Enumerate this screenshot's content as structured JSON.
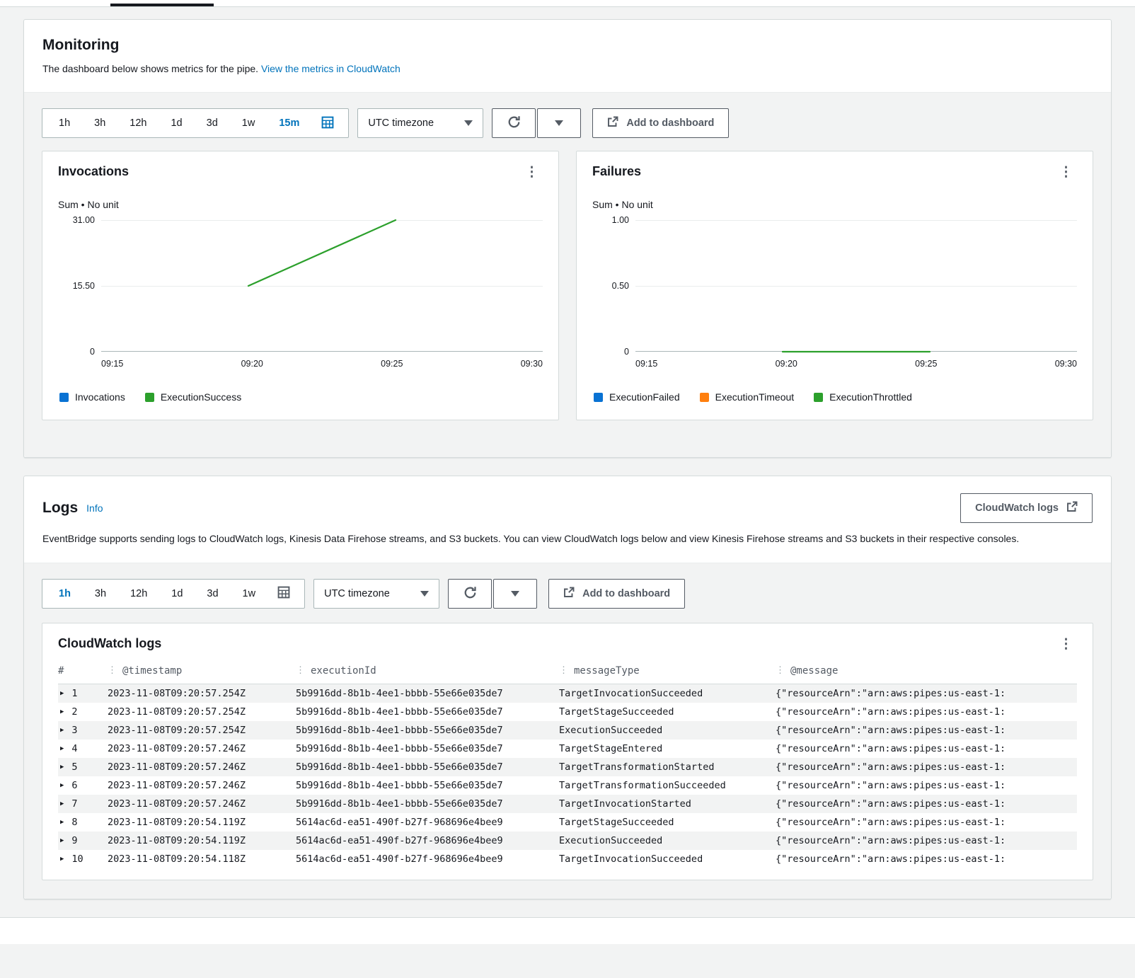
{
  "icons": {
    "kebab_menu": "⋮",
    "expand_row": "▶"
  },
  "colors": {
    "accent_blue": "#0073bb",
    "button_gray": "#545b64",
    "chart_blue": "#0972d3",
    "chart_green": "#2ca02c",
    "chart_orange": "#ff7f0e"
  },
  "monitoring": {
    "title": "Monitoring",
    "description": "The dashboard below shows metrics for the pipe.",
    "metrics_link": "View the metrics in CloudWatch",
    "time_ranges": [
      "1h",
      "3h",
      "12h",
      "1d",
      "3d",
      "1w",
      "15m"
    ],
    "selected_range": "15m",
    "timezone_label": "UTC timezone",
    "add_to_dashboard_label": "Add to dashboard"
  },
  "logs": {
    "title": "Logs",
    "info_label": "Info",
    "cloudwatch_logs_button": "CloudWatch logs",
    "description": "EventBridge supports sending logs to CloudWatch logs, Kinesis Data Firehose streams, and S3 buckets. You can view CloudWatch logs below and view Kinesis Firehose streams and S3 buckets in their respective consoles.",
    "time_ranges": [
      "1h",
      "3h",
      "12h",
      "1d",
      "3d",
      "1w"
    ],
    "selected_range": "1h",
    "timezone_label": "UTC timezone",
    "add_to_dashboard_label": "Add to dashboard",
    "table": {
      "title": "CloudWatch logs",
      "columns": [
        "#",
        "@timestamp",
        "executionId",
        "messageType",
        "@message"
      ],
      "rows": [
        {
          "n": "1",
          "timestamp": "2023-11-08T09:20:57.254Z",
          "executionId": "5b9916dd-8b1b-4ee1-bbbb-55e66e035de7",
          "messageType": "TargetInvocationSucceeded",
          "message": "{\"resourceArn\":\"arn:aws:pipes:us-east-1:"
        },
        {
          "n": "2",
          "timestamp": "2023-11-08T09:20:57.254Z",
          "executionId": "5b9916dd-8b1b-4ee1-bbbb-55e66e035de7",
          "messageType": "TargetStageSucceeded",
          "message": "{\"resourceArn\":\"arn:aws:pipes:us-east-1:"
        },
        {
          "n": "3",
          "timestamp": "2023-11-08T09:20:57.254Z",
          "executionId": "5b9916dd-8b1b-4ee1-bbbb-55e66e035de7",
          "messageType": "ExecutionSucceeded",
          "message": "{\"resourceArn\":\"arn:aws:pipes:us-east-1:"
        },
        {
          "n": "4",
          "timestamp": "2023-11-08T09:20:57.246Z",
          "executionId": "5b9916dd-8b1b-4ee1-bbbb-55e66e035de7",
          "messageType": "TargetStageEntered",
          "message": "{\"resourceArn\":\"arn:aws:pipes:us-east-1:"
        },
        {
          "n": "5",
          "timestamp": "2023-11-08T09:20:57.246Z",
          "executionId": "5b9916dd-8b1b-4ee1-bbbb-55e66e035de7",
          "messageType": "TargetTransformationStarted",
          "message": "{\"resourceArn\":\"arn:aws:pipes:us-east-1:"
        },
        {
          "n": "6",
          "timestamp": "2023-11-08T09:20:57.246Z",
          "executionId": "5b9916dd-8b1b-4ee1-bbbb-55e66e035de7",
          "messageType": "TargetTransformationSucceeded",
          "message": "{\"resourceArn\":\"arn:aws:pipes:us-east-1:"
        },
        {
          "n": "7",
          "timestamp": "2023-11-08T09:20:57.246Z",
          "executionId": "5b9916dd-8b1b-4ee1-bbbb-55e66e035de7",
          "messageType": "TargetInvocationStarted",
          "message": "{\"resourceArn\":\"arn:aws:pipes:us-east-1:"
        },
        {
          "n": "8",
          "timestamp": "2023-11-08T09:20:54.119Z",
          "executionId": "5614ac6d-ea51-490f-b27f-968696e4bee9",
          "messageType": "TargetStageSucceeded",
          "message": "{\"resourceArn\":\"arn:aws:pipes:us-east-1:"
        },
        {
          "n": "9",
          "timestamp": "2023-11-08T09:20:54.119Z",
          "executionId": "5614ac6d-ea51-490f-b27f-968696e4bee9",
          "messageType": "ExecutionSucceeded",
          "message": "{\"resourceArn\":\"arn:aws:pipes:us-east-1:"
        },
        {
          "n": "10",
          "timestamp": "2023-11-08T09:20:54.118Z",
          "executionId": "5614ac6d-ea51-490f-b27f-968696e4bee9",
          "messageType": "TargetInvocationSucceeded",
          "message": "{\"resourceArn\":\"arn:aws:pipes:us-east-1:"
        }
      ]
    }
  },
  "chart_data": [
    {
      "type": "line",
      "title": "Invocations",
      "subtitle": "Sum • No unit",
      "x_ticks": [
        "09:15",
        "09:20",
        "09:25",
        "09:30"
      ],
      "y_ticks": [
        "31.00",
        "15.50",
        "0"
      ],
      "ylim": [
        0,
        31
      ],
      "grid": true,
      "legend_position": "bottom",
      "series": [
        {
          "name": "Invocations",
          "color": "#0972d3",
          "points": []
        },
        {
          "name": "ExecutionSuccess",
          "color": "#2ca02c",
          "points": [
            {
              "x": "09:20",
              "y": 15.5
            },
            {
              "x": "09:25",
              "y": 31
            }
          ]
        }
      ],
      "legend": [
        {
          "label": "Invocations",
          "color": "#0972d3"
        },
        {
          "label": "ExecutionSuccess",
          "color": "#2ca02c"
        }
      ]
    },
    {
      "type": "line",
      "title": "Failures",
      "subtitle": "Sum • No unit",
      "x_ticks": [
        "09:15",
        "09:20",
        "09:25",
        "09:30"
      ],
      "y_ticks": [
        "1.00",
        "0.50",
        "0"
      ],
      "ylim": [
        0,
        1
      ],
      "grid": true,
      "legend_position": "bottom",
      "series": [
        {
          "name": "ExecutionFailed",
          "color": "#0972d3",
          "points": []
        },
        {
          "name": "ExecutionTimeout",
          "color": "#ff7f0e",
          "points": []
        },
        {
          "name": "ExecutionThrottled",
          "color": "#2ca02c",
          "points": [
            {
              "x": "09:20",
              "y": 0
            },
            {
              "x": "09:25",
              "y": 0
            }
          ]
        }
      ],
      "legend": [
        {
          "label": "ExecutionFailed",
          "color": "#0972d3"
        },
        {
          "label": "ExecutionTimeout",
          "color": "#ff7f0e"
        },
        {
          "label": "ExecutionThrottled",
          "color": "#2ca02c"
        }
      ]
    }
  ]
}
